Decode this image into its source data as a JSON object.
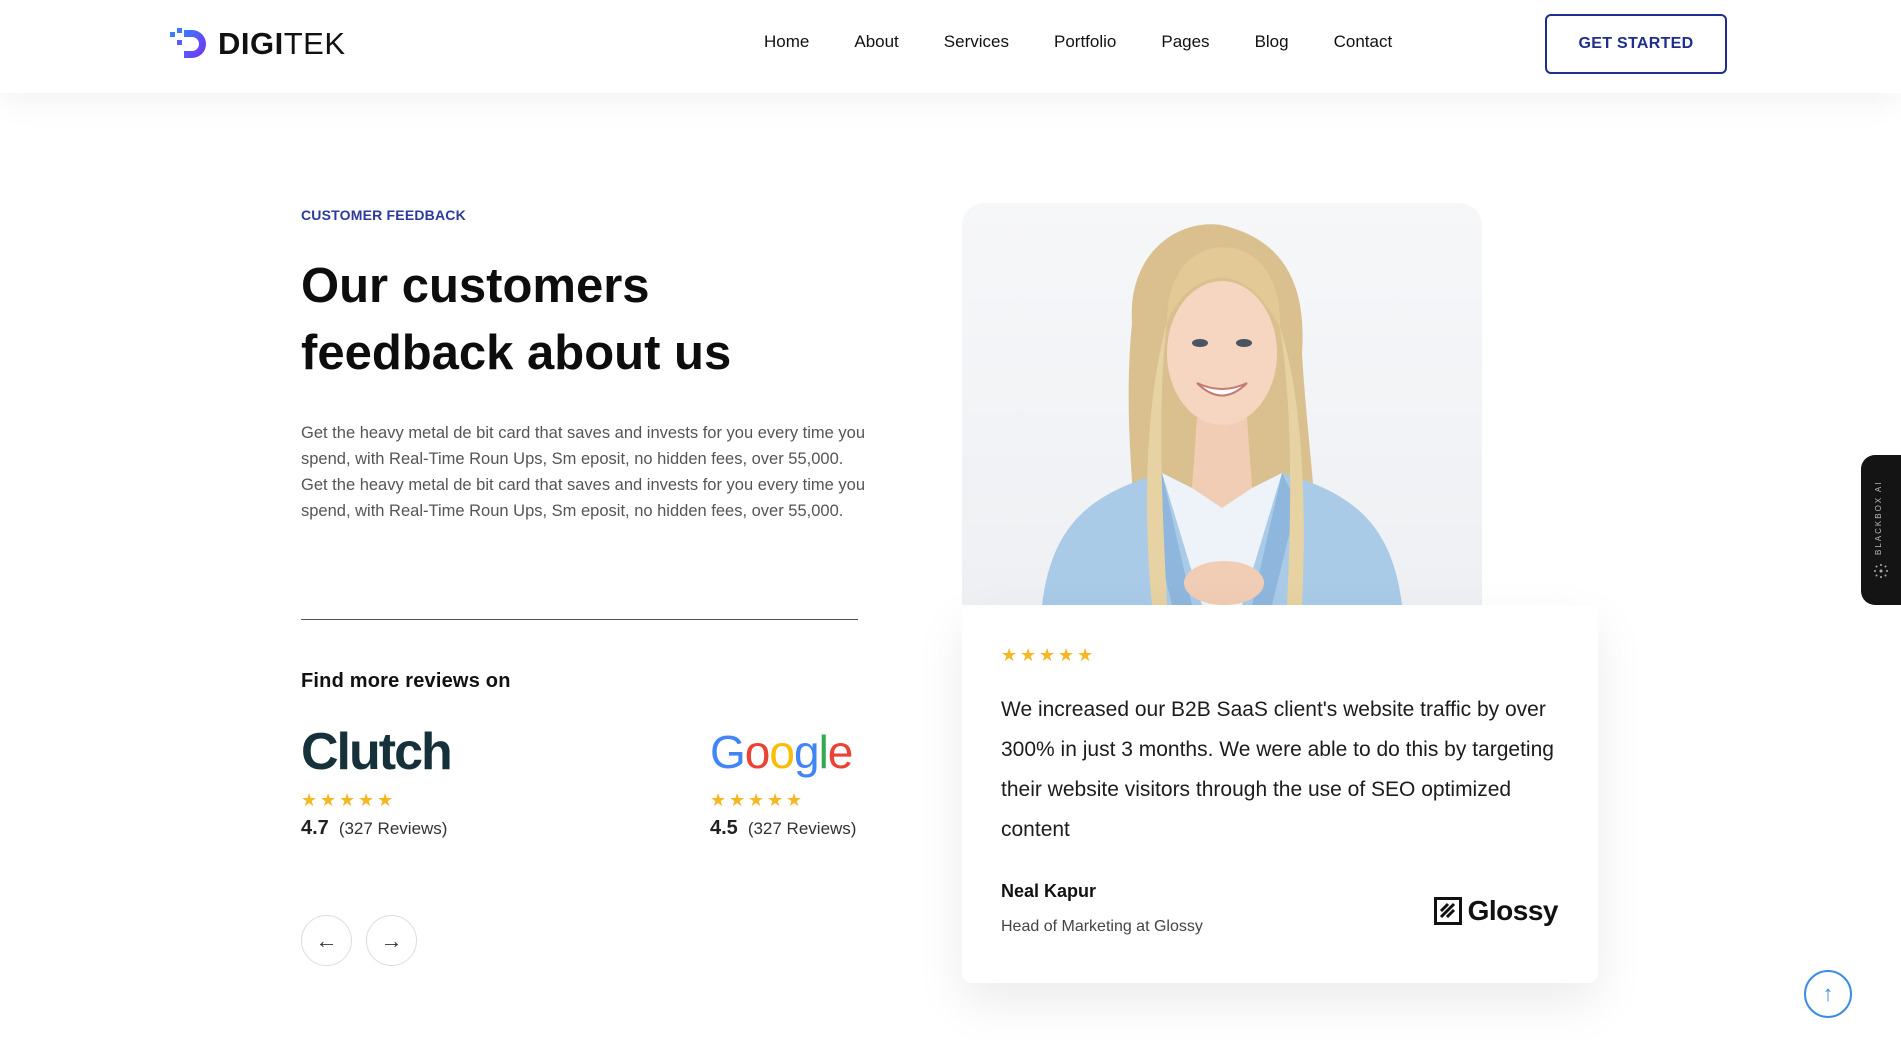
{
  "brand": {
    "name_part1": "DIGI",
    "name_part2": "TEK",
    "accent": "#4a3cf0"
  },
  "nav": {
    "items": [
      "Home",
      "About",
      "Services",
      "Portfolio",
      "Pages",
      "Blog",
      "Contact"
    ]
  },
  "header": {
    "cta_label": "GET STARTED"
  },
  "section": {
    "eyebrow": "CUSTOMER FEEDBACK",
    "title_line1": "Our customers",
    "title_line2": "feedback about us",
    "paragraph_1": "Get the heavy metal de bit card that saves and invests for you every time you spend, with Real-Time Roun Ups, Sm eposit, no hidden fees, over 55,000.",
    "paragraph_2": "Get the heavy metal de bit card that saves and invests for you every time you spend, with Real-Time Roun Ups, Sm eposit, no hidden fees, over 55,000.",
    "find_more": "Find more reviews on"
  },
  "reviews": [
    {
      "platform": "Clutch",
      "rating": "4.7",
      "count": "(327 Reviews)"
    },
    {
      "platform": "Google",
      "rating": "4.5",
      "count": "(327 Reviews)"
    }
  ],
  "carousel": {
    "prev_icon": "arrow-left-icon",
    "next_icon": "arrow-right-icon"
  },
  "testimonial": {
    "stars": 5,
    "quote": "We increased our B2B SaaS client's website traffic by over 300% in just 3 months. We were able to do this by targeting their website visitors through the use of SEO optimized content",
    "author_name": "Neal Kapur",
    "author_role": "Head of Marketing at Glossy",
    "company": "Glossy"
  },
  "side_widget": {
    "label": "BLACKBOX AI"
  },
  "colors": {
    "primary": "#1f2e8c",
    "star": "#f5b723",
    "scroll_top": "#3d8de6"
  }
}
